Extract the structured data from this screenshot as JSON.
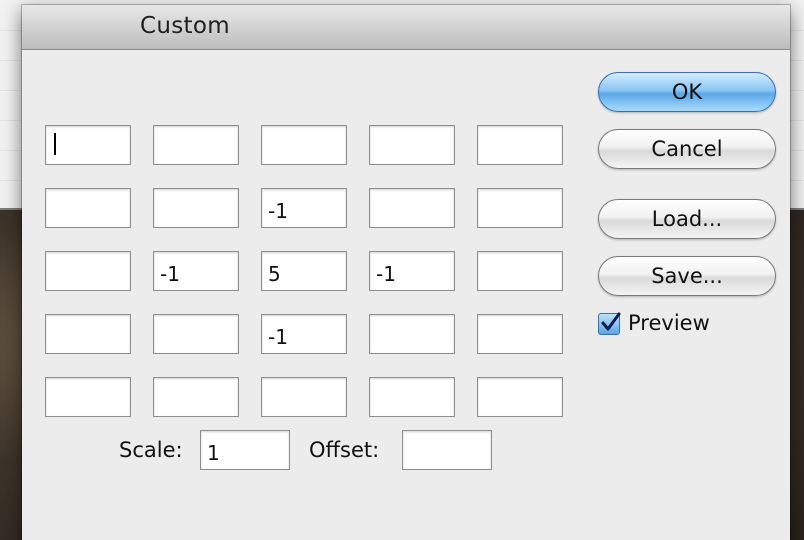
{
  "dialog": {
    "title": "Custom",
    "matrix": [
      [
        "",
        "",
        "",
        "",
        ""
      ],
      [
        "",
        "",
        "-1",
        "",
        ""
      ],
      [
        "",
        "-1",
        "5",
        "-1",
        ""
      ],
      [
        "",
        "",
        "-1",
        "",
        ""
      ],
      [
        "",
        "",
        "",
        "",
        ""
      ]
    ],
    "scale_label": "Scale:",
    "scale_value": "1",
    "offset_label": "Offset:",
    "offset_value": ""
  },
  "buttons": {
    "ok": "OK",
    "cancel": "Cancel",
    "load": "Load...",
    "save": "Save..."
  },
  "preview": {
    "label": "Preview",
    "checked": true
  }
}
